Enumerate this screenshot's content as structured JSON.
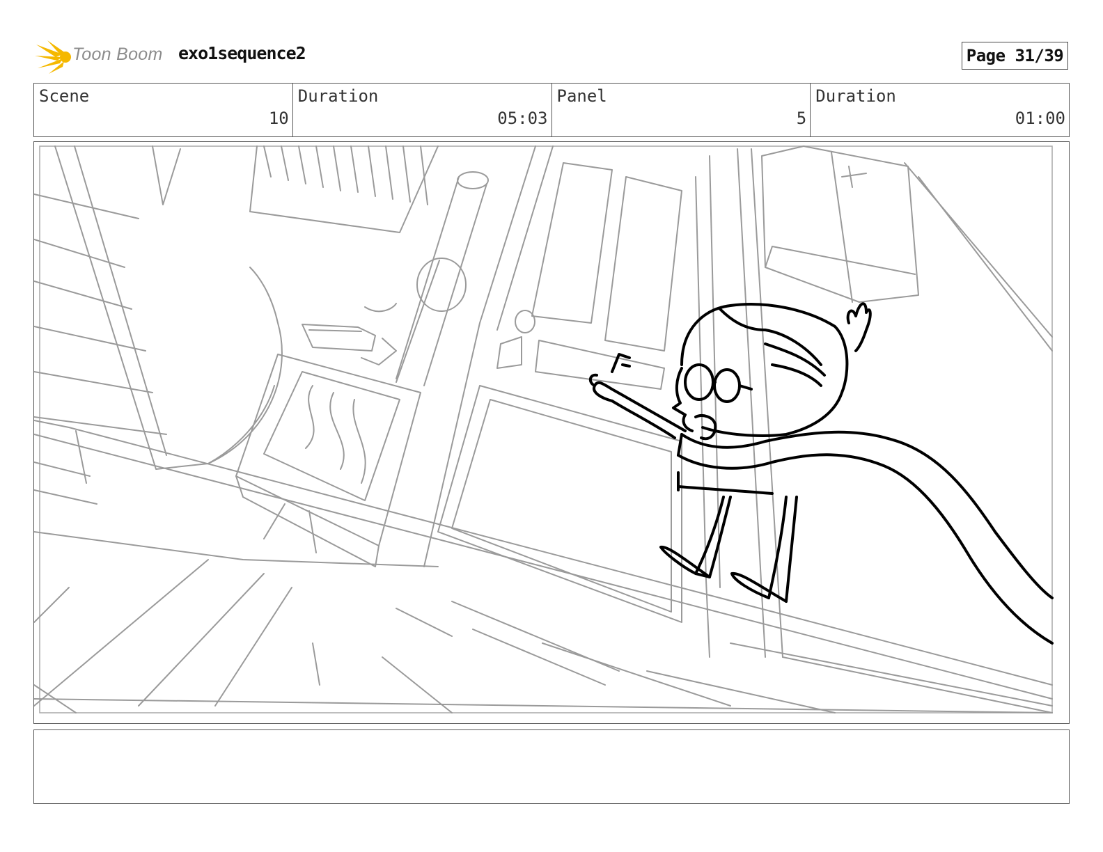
{
  "header": {
    "brand": "Toon Boom",
    "sequence_title": "exo1sequence2",
    "page_label": "Page 31/39"
  },
  "info": {
    "scene_label": "Scene",
    "scene_value": "10",
    "scene_duration_label": "Duration",
    "scene_duration_value": "05:03",
    "panel_label": "Panel",
    "panel_value": "5",
    "panel_duration_label": "Duration",
    "panel_duration_value": "01:00"
  },
  "colors": {
    "logo_flame": "#f5b800",
    "sketch_background": "#9a9a9a",
    "sketch_character": "#000000"
  },
  "notes": {
    "text": ""
  }
}
